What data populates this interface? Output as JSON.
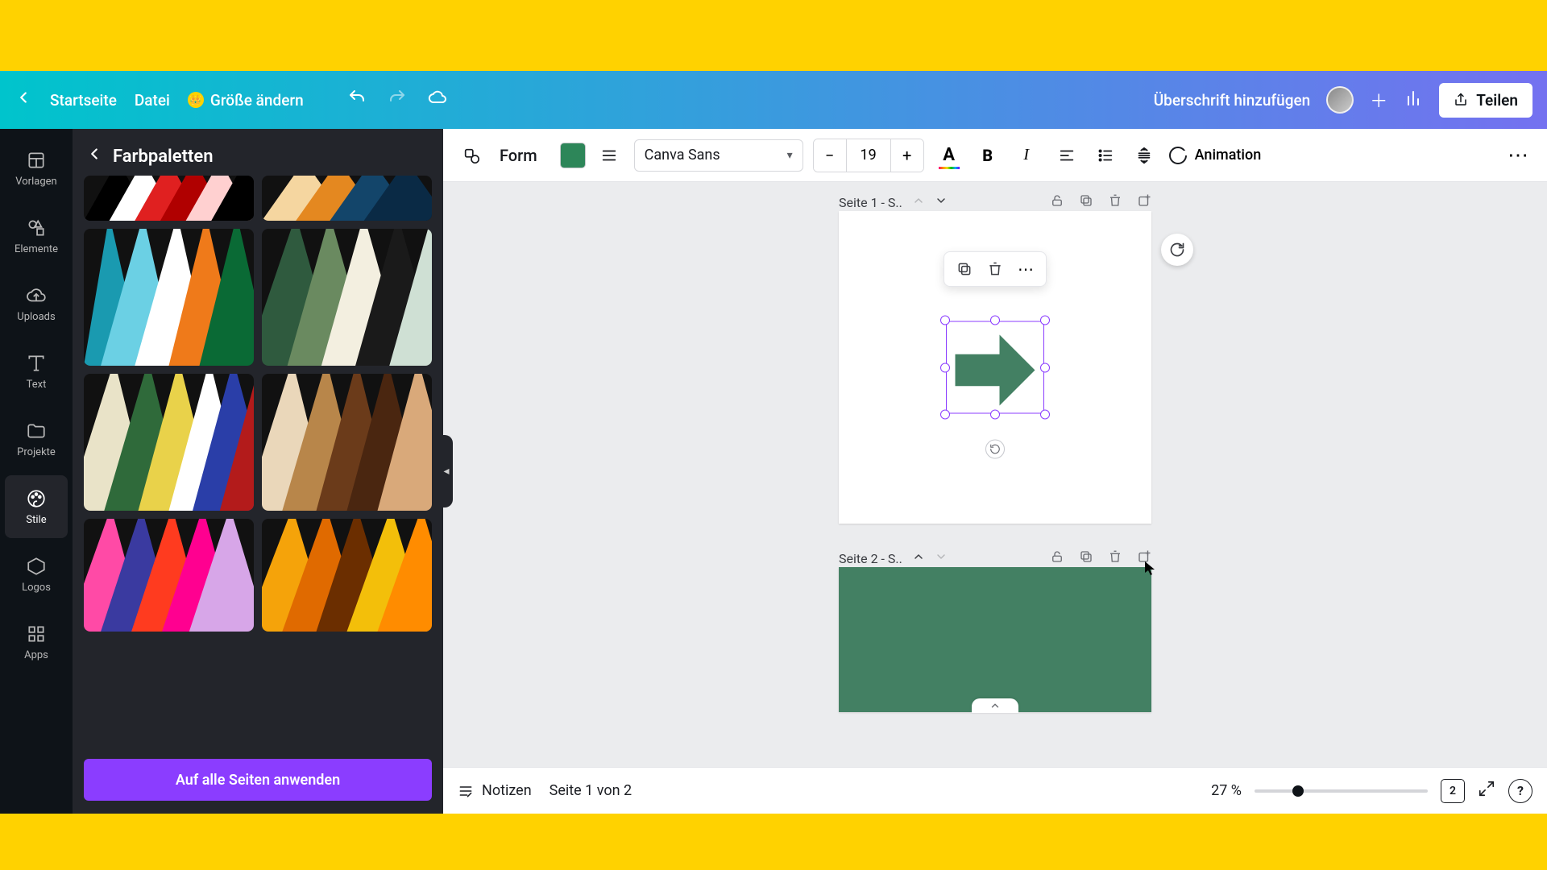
{
  "topbar": {
    "home": "Startseite",
    "file": "Datei",
    "resize": "Größe ändern",
    "title": "Überschrift hinzufügen",
    "share": "Teilen"
  },
  "vnav": {
    "templates": "Vorlagen",
    "elements": "Elemente",
    "uploads": "Uploads",
    "text": "Text",
    "projects": "Projekte",
    "styles": "Stile",
    "logos": "Logos",
    "apps": "Apps"
  },
  "sidepanel": {
    "title": "Farbpaletten",
    "apply": "Auf alle Seiten anwenden"
  },
  "ctoolbar": {
    "form": "Form",
    "font": "Canva Sans",
    "size": "19",
    "animation": "Animation"
  },
  "canvas": {
    "page1_label": "Seite 1 - S..",
    "page2_label": "Seite 2 - S..",
    "arrow_fill": "#438063"
  },
  "bottombar": {
    "notes": "Notizen",
    "pageinfo": "Seite 1 von 2",
    "zoom_text": "27 %",
    "page_count": "2"
  },
  "colors": {
    "accent": "#8b3dff",
    "green": "#438063"
  }
}
